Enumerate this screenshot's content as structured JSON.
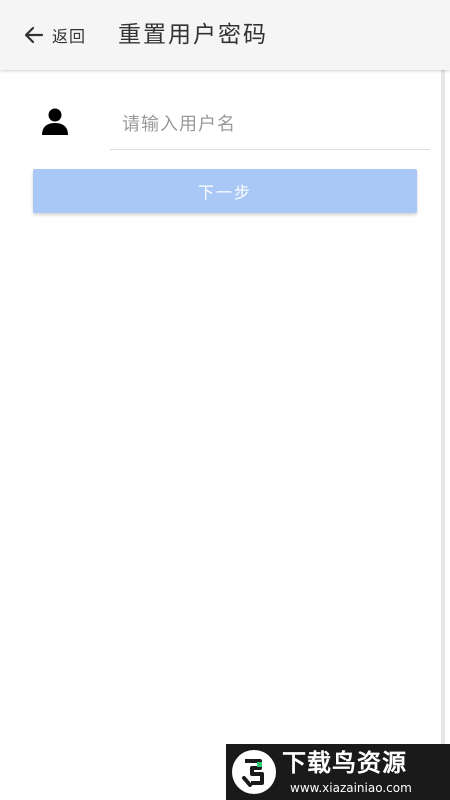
{
  "header": {
    "back_label": "返回",
    "title": "重置用户密码",
    "back_icon": "arrow-left-icon"
  },
  "form": {
    "user_icon": "person-icon",
    "username_placeholder": "请输入用户名",
    "username_value": "",
    "next_label": "下一步",
    "next_button_color": "#aac8f6"
  },
  "watermark": {
    "title": "下载鸟资源",
    "url": "www.xiazainiao.com"
  }
}
